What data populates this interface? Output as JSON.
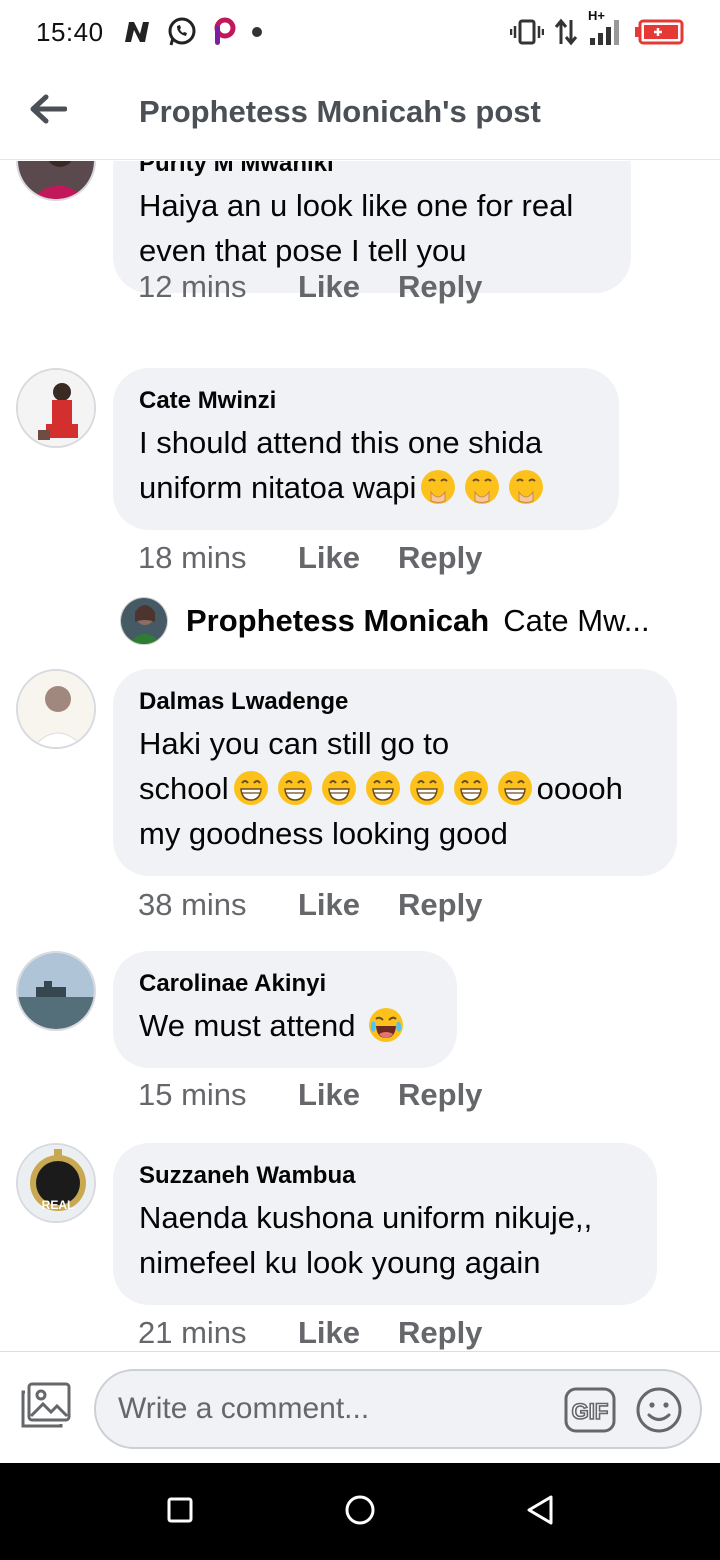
{
  "status_bar": {
    "time": "15:40",
    "network_label": "H+",
    "left_icons": [
      "n-app-icon",
      "whatsapp-icon",
      "picsart-icon",
      "dot-icon"
    ],
    "right_icons": [
      "vibrate-icon",
      "data-transfer-icon",
      "signal-icon",
      "battery-icon"
    ],
    "battery_color": "#e53935"
  },
  "header": {
    "title": "Prophetess Monicah's post"
  },
  "comments": [
    {
      "author": "Purity M Mwaniki",
      "text_lines": [
        "Haiya an u look like one for real",
        "even that pose  I tell you"
      ],
      "time": "12 mins",
      "like": "Like",
      "reply": "Reply"
    },
    {
      "author": "Cate Mwinzi",
      "text_lines": [
        "I should attend this one shida",
        "uniform nitatoa wapi"
      ],
      "emoji": "face-with-hand-over-mouth",
      "emoji_count": 3,
      "time": "18 mins",
      "like": "Like",
      "reply": "Reply"
    },
    {
      "author": "Dalmas Lwadenge",
      "text_lines": [
        "Haki you can still go to",
        "school",
        "ooooh",
        "my goodness looking good"
      ],
      "emoji": "grinning-face",
      "emoji_count": 7,
      "time": "38 mins",
      "like": "Like",
      "reply": "Reply"
    },
    {
      "author": "Carolinae Akinyi",
      "text_lines": [
        "We must attend"
      ],
      "emoji": "face-with-tears-of-joy",
      "emoji_count": 1,
      "time": "15 mins",
      "like": "Like",
      "reply": "Reply"
    },
    {
      "author": "Suzzaneh Wambua",
      "text_lines": [
        "Naenda kushona uniform nikuje,,",
        "nimefeel ku look young again"
      ],
      "time": "21 mins",
      "like": "Like",
      "reply": "Reply"
    }
  ],
  "reply_preview": {
    "author": "Prophetess Monicah",
    "snippet": "Cate Mw..."
  },
  "avatar_badge_text": "REAL",
  "composer": {
    "placeholder": "Write a comment...",
    "gif_label": "GIF"
  },
  "colors": {
    "bubble_bg": "#f0f2f5",
    "meta_text": "#65676b",
    "header_title": "#4b4f56"
  }
}
